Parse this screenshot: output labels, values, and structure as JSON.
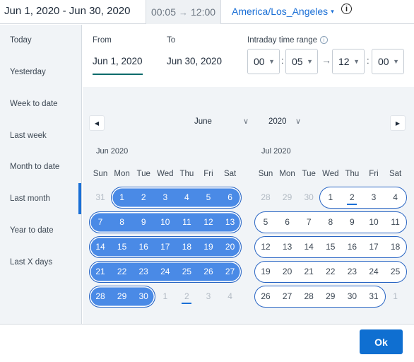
{
  "header": {
    "range_text": "Jun 1, 2020 - Jun 30, 2020",
    "time_start": "00:05",
    "time_end": "12:00",
    "time_arrow": "→",
    "timezone": "America/Los_Angeles",
    "timezone_caret": "▾",
    "info_glyph": "i"
  },
  "sidebar": {
    "items": [
      {
        "label": "Today"
      },
      {
        "label": "Yesterday"
      },
      {
        "label": "Week to date"
      },
      {
        "label": "Last week"
      },
      {
        "label": "Month to date"
      },
      {
        "label": "Last month"
      },
      {
        "label": "Year to date"
      },
      {
        "label": "Last X days"
      }
    ],
    "active": "Last month"
  },
  "form": {
    "from_label": "From",
    "to_label": "To",
    "from_value": "Jun 1, 2020",
    "to_value": "Jun 30, 2020",
    "intraday_label": "Intraday time range",
    "info_glyph": "i",
    "start_hour": "00",
    "start_minute": "05",
    "end_hour": "12",
    "end_minute": "00",
    "colon": ":",
    "arrow": "→",
    "caret": "▼"
  },
  "calendar": {
    "prev_glyph": "◀",
    "next_glyph": "▶",
    "month_select": "June",
    "year_select": "2020",
    "chevron": "∨",
    "weekdays": [
      "Sun",
      "Mon",
      "Tue",
      "Wed",
      "Thu",
      "Fri",
      "Sat"
    ],
    "left": {
      "title": "Jun 2020",
      "weeks": [
        [
          {
            "d": "31",
            "o": true
          },
          {
            "d": "1"
          },
          {
            "d": "2"
          },
          {
            "d": "3"
          },
          {
            "d": "4"
          },
          {
            "d": "5"
          },
          {
            "d": "6"
          }
        ],
        [
          {
            "d": "7"
          },
          {
            "d": "8"
          },
          {
            "d": "9"
          },
          {
            "d": "10"
          },
          {
            "d": "11"
          },
          {
            "d": "12"
          },
          {
            "d": "13"
          }
        ],
        [
          {
            "d": "14"
          },
          {
            "d": "15"
          },
          {
            "d": "16"
          },
          {
            "d": "17"
          },
          {
            "d": "18"
          },
          {
            "d": "19"
          },
          {
            "d": "20"
          }
        ],
        [
          {
            "d": "21"
          },
          {
            "d": "22"
          },
          {
            "d": "23"
          },
          {
            "d": "24"
          },
          {
            "d": "25"
          },
          {
            "d": "26"
          },
          {
            "d": "27"
          }
        ],
        [
          {
            "d": "28"
          },
          {
            "d": "29"
          },
          {
            "d": "30"
          },
          {
            "d": "1",
            "o": true
          },
          {
            "d": "2",
            "o": true,
            "t": true
          },
          {
            "d": "3",
            "o": true
          },
          {
            "d": "4",
            "o": true
          }
        ]
      ],
      "selected_range": "Jun 1 – Jun 30"
    },
    "right": {
      "title": "Jul 2020",
      "weeks": [
        [
          {
            "d": "28",
            "o": true
          },
          {
            "d": "29",
            "o": true
          },
          {
            "d": "30",
            "o": true
          },
          {
            "d": "1"
          },
          {
            "d": "2",
            "t": true
          },
          {
            "d": "3"
          },
          {
            "d": "4"
          }
        ],
        [
          {
            "d": "5"
          },
          {
            "d": "6"
          },
          {
            "d": "7"
          },
          {
            "d": "8"
          },
          {
            "d": "9"
          },
          {
            "d": "10"
          },
          {
            "d": "11"
          }
        ],
        [
          {
            "d": "12"
          },
          {
            "d": "13"
          },
          {
            "d": "14"
          },
          {
            "d": "15"
          },
          {
            "d": "16"
          },
          {
            "d": "17"
          },
          {
            "d": "18"
          }
        ],
        [
          {
            "d": "19"
          },
          {
            "d": "20"
          },
          {
            "d": "21"
          },
          {
            "d": "22"
          },
          {
            "d": "23"
          },
          {
            "d": "24"
          },
          {
            "d": "25"
          }
        ],
        [
          {
            "d": "26"
          },
          {
            "d": "27"
          },
          {
            "d": "28"
          },
          {
            "d": "29"
          },
          {
            "d": "30"
          },
          {
            "d": "31"
          },
          {
            "d": "1",
            "o": true
          }
        ]
      ]
    }
  },
  "footer": {
    "ok_label": "Ok"
  },
  "colors": {
    "accent": "#0f6fd1",
    "selected_fill": "#4a8ae6",
    "selected_border": "#2a66c4",
    "sidebar_bg": "#f1f4f7"
  }
}
